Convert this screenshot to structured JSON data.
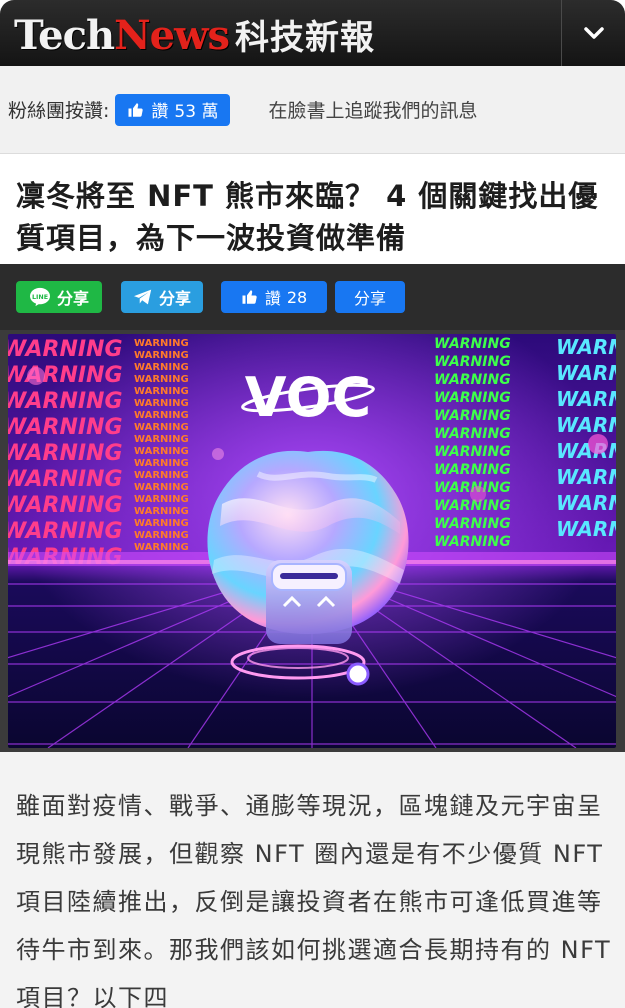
{
  "header": {
    "logo_tech": "Tech",
    "logo_news": "News",
    "logo_cn": "科技新報",
    "menu_icon": "chevron-down-icon"
  },
  "fanbar": {
    "label": "粉絲團按讚:",
    "like_label": "讚",
    "like_count": "53 萬",
    "follow_text": "在臉書上追蹤我們的訊息"
  },
  "article": {
    "title": "凜冬將至 NFT 熊市來臨？ 4 個關鍵找出優質項目，為下一波投資做準備",
    "body": "雖面對疫情、戰爭、通膨等現況，區塊鏈及元宇宙呈現熊市發展，但觀察 NFT 圈內還是有不少優質 NFT 項目陸續推出，反倒是讓投資者在熊市可逢低買進等待牛市到來。那我們該如何挑選適合長期持有的 NFT 項目？以下四"
  },
  "sharebar": {
    "line_label": "分享",
    "telegram_label": "分享",
    "like_label": "讚",
    "like_count": "28",
    "fb_share_label": "分享"
  },
  "hero": {
    "logo_text": "VOC",
    "warning_text": "WARNING",
    "colors": {
      "bg_top": "#3a0a8a",
      "bg_bottom": "#0a0630",
      "pink": "#ff3d8b",
      "orange": "#ff7a2a",
      "green": "#3dff4a",
      "cyan": "#59e8ff",
      "grid": "#b43cff"
    }
  },
  "colors": {
    "header_bg": "#1a1a1a",
    "brand_red": "#e3221b",
    "facebook_blue": "#1877f2",
    "line_green": "#1fb845",
    "telegram_blue": "#2a9ee0"
  }
}
